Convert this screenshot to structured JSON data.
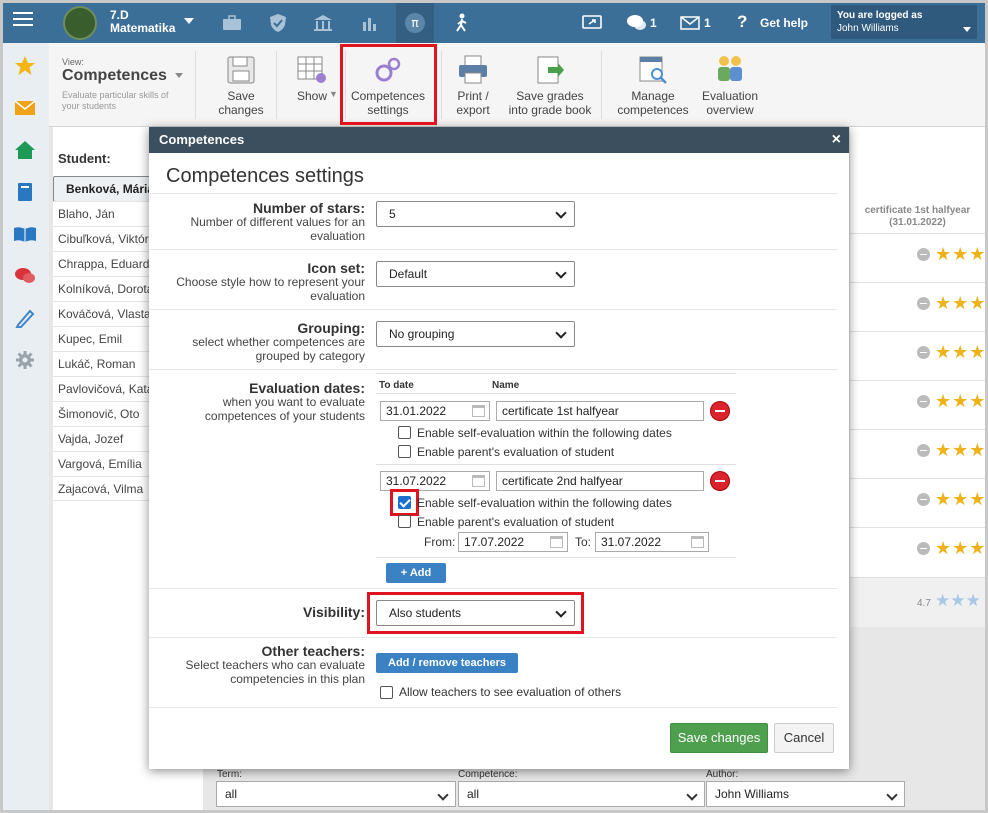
{
  "header": {
    "class_name": "7.D",
    "subject": "Matematika",
    "messages_count": "1",
    "mail_count": "1",
    "help_label": "Get help",
    "logged_label": "You are logged as",
    "user_name": "John Williams",
    "nav_icons": [
      "briefcase-icon",
      "shield-icon",
      "bank-icon",
      "bar-chart-icon",
      "pi-icon",
      "walking-icon"
    ]
  },
  "sidebar": {
    "icons": [
      "star-icon",
      "mail-icon",
      "home-icon",
      "book-icon",
      "open-book-icon",
      "chat-icon",
      "pen-icon",
      "gear-icon"
    ]
  },
  "toolbar": {
    "view_label": "View:",
    "view_title": "Competences",
    "view_subtitle": "Evaluate particular skills of your students",
    "save": [
      "Save",
      "changes"
    ],
    "show": "Show",
    "comp_settings": [
      "Competences",
      "settings"
    ],
    "print": [
      "Print /",
      "export"
    ],
    "save_grades": [
      "Save grades",
      "into grade book"
    ],
    "manage": [
      "Manage",
      "competences"
    ],
    "eval_overview": [
      "Evaluation",
      "overview"
    ]
  },
  "students": {
    "label": "Student:",
    "list": [
      "Benková, Mária",
      "Blaho, Ján",
      "Cibuľková, Viktória",
      "Chrappa, Eduard",
      "Kolníková, Dorota",
      "Kováčová, Vlasta",
      "Kupec, Emil",
      "Lukáč, Roman",
      "Pavlovičová, Katarína",
      "Šimonovič, Oto",
      "Vajda, Jozef",
      "Vargová, Emília",
      "Zajacová, Vilma"
    ]
  },
  "evaluation": {
    "column_title": "certificate 1st halfyear",
    "column_date": "(31.01.2022)",
    "average": "4.7",
    "star_color": "#f0b21a"
  },
  "filters": {
    "term_label": "Term:",
    "term_value": "all",
    "competence_label": "Competence:",
    "competence_value": "all",
    "author_label": "Author:",
    "author_value": "John Williams"
  },
  "modal": {
    "header": "Competences",
    "close": "×",
    "title": "Competences settings",
    "stars": {
      "label": "Number of stars:",
      "desc": "Number of different values for an evaluation",
      "value": "5"
    },
    "iconset": {
      "label": "Icon set:",
      "desc": "Choose style how to represent your evaluation",
      "value": "Default"
    },
    "grouping": {
      "label": "Grouping:",
      "desc": "select whether competences are grouped by category",
      "value": "No grouping"
    },
    "dates": {
      "label": "Evaluation dates:",
      "desc": "when you want to evaluate competences of your students",
      "col_date": "To date",
      "col_name": "Name",
      "entries": [
        {
          "date": "31.01.2022",
          "name": "certificate 1st halfyear",
          "self_eval": false,
          "parent_eval": false
        },
        {
          "date": "31.07.2022",
          "name": "certificate 2nd halfyear",
          "self_eval": true,
          "parent_eval": false
        }
      ],
      "self_eval_label": "Enable self-evaluation within the following dates",
      "parent_eval_label": "Enable parent's evaluation of student",
      "from_label": "From:",
      "from_value": "17.07.2022",
      "to_label": "To:",
      "to_value": "31.07.2022",
      "add_label": "+ Add"
    },
    "visibility": {
      "label": "Visibility:",
      "value": "Also students"
    },
    "teachers": {
      "label": "Other teachers:",
      "desc": "Select teachers who can evaluate competencies in this plan",
      "button": "Add / remove teachers",
      "allow_label": "Allow teachers to see evaluation of others"
    },
    "save_label": "Save changes",
    "cancel_label": "Cancel"
  },
  "highlight_color": "#e0141e"
}
